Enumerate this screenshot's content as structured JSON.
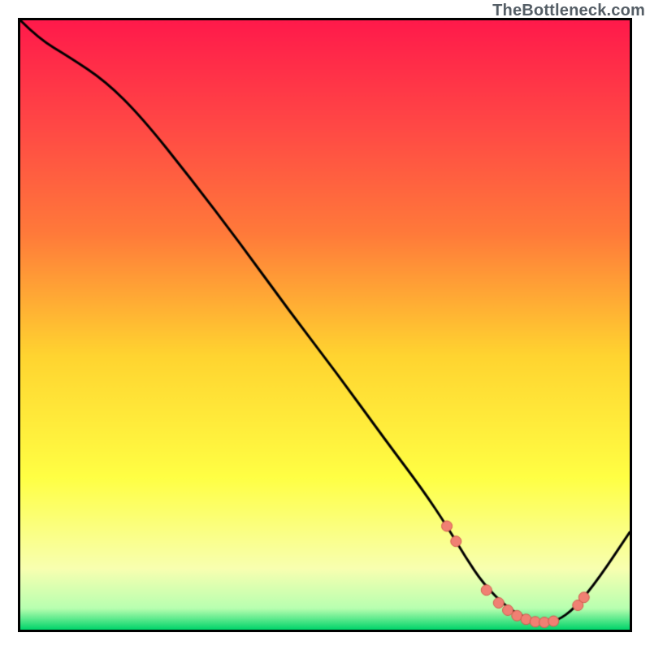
{
  "watermark": "TheBottleneck.com",
  "colors": {
    "gradient_top": "#ff1a4b",
    "gradient_mid_upper": "#ff7a3a",
    "gradient_mid": "#ffd430",
    "gradient_mid_lower": "#ffff44",
    "gradient_pale": "#f8ffb0",
    "gradient_bottom": "#00d46a",
    "curve": "#000000",
    "dot_fill": "#f08073",
    "dot_stroke": "#d0584c"
  },
  "chart_data": {
    "type": "line",
    "title": "",
    "xlabel": "",
    "ylabel": "",
    "xlim": [
      0,
      100
    ],
    "ylim": [
      0,
      100
    ],
    "series": [
      {
        "name": "bottleneck-curve",
        "x": [
          0,
          3,
          8,
          14,
          20,
          28,
          36,
          44,
          52,
          60,
          66,
          70,
          73,
          76,
          80,
          83.5,
          86,
          88,
          91,
          95,
          100
        ],
        "y": [
          100,
          97,
          94,
          90,
          84,
          74,
          63.5,
          52.5,
          42,
          31,
          23,
          17,
          12,
          7.5,
          3.5,
          1.6,
          1.2,
          1.4,
          3.5,
          8.5,
          16
        ]
      }
    ],
    "scatter_points": {
      "name": "highlight-dots",
      "points": [
        {
          "x": 70.0,
          "y": 17.0
        },
        {
          "x": 71.5,
          "y": 14.5
        },
        {
          "x": 76.5,
          "y": 6.5
        },
        {
          "x": 78.5,
          "y": 4.4
        },
        {
          "x": 80.0,
          "y": 3.2
        },
        {
          "x": 81.5,
          "y": 2.3
        },
        {
          "x": 83.0,
          "y": 1.7
        },
        {
          "x": 84.5,
          "y": 1.3
        },
        {
          "x": 86.0,
          "y": 1.2
        },
        {
          "x": 87.5,
          "y": 1.4
        },
        {
          "x": 91.5,
          "y": 4.0
        },
        {
          "x": 92.5,
          "y": 5.3
        }
      ]
    }
  }
}
